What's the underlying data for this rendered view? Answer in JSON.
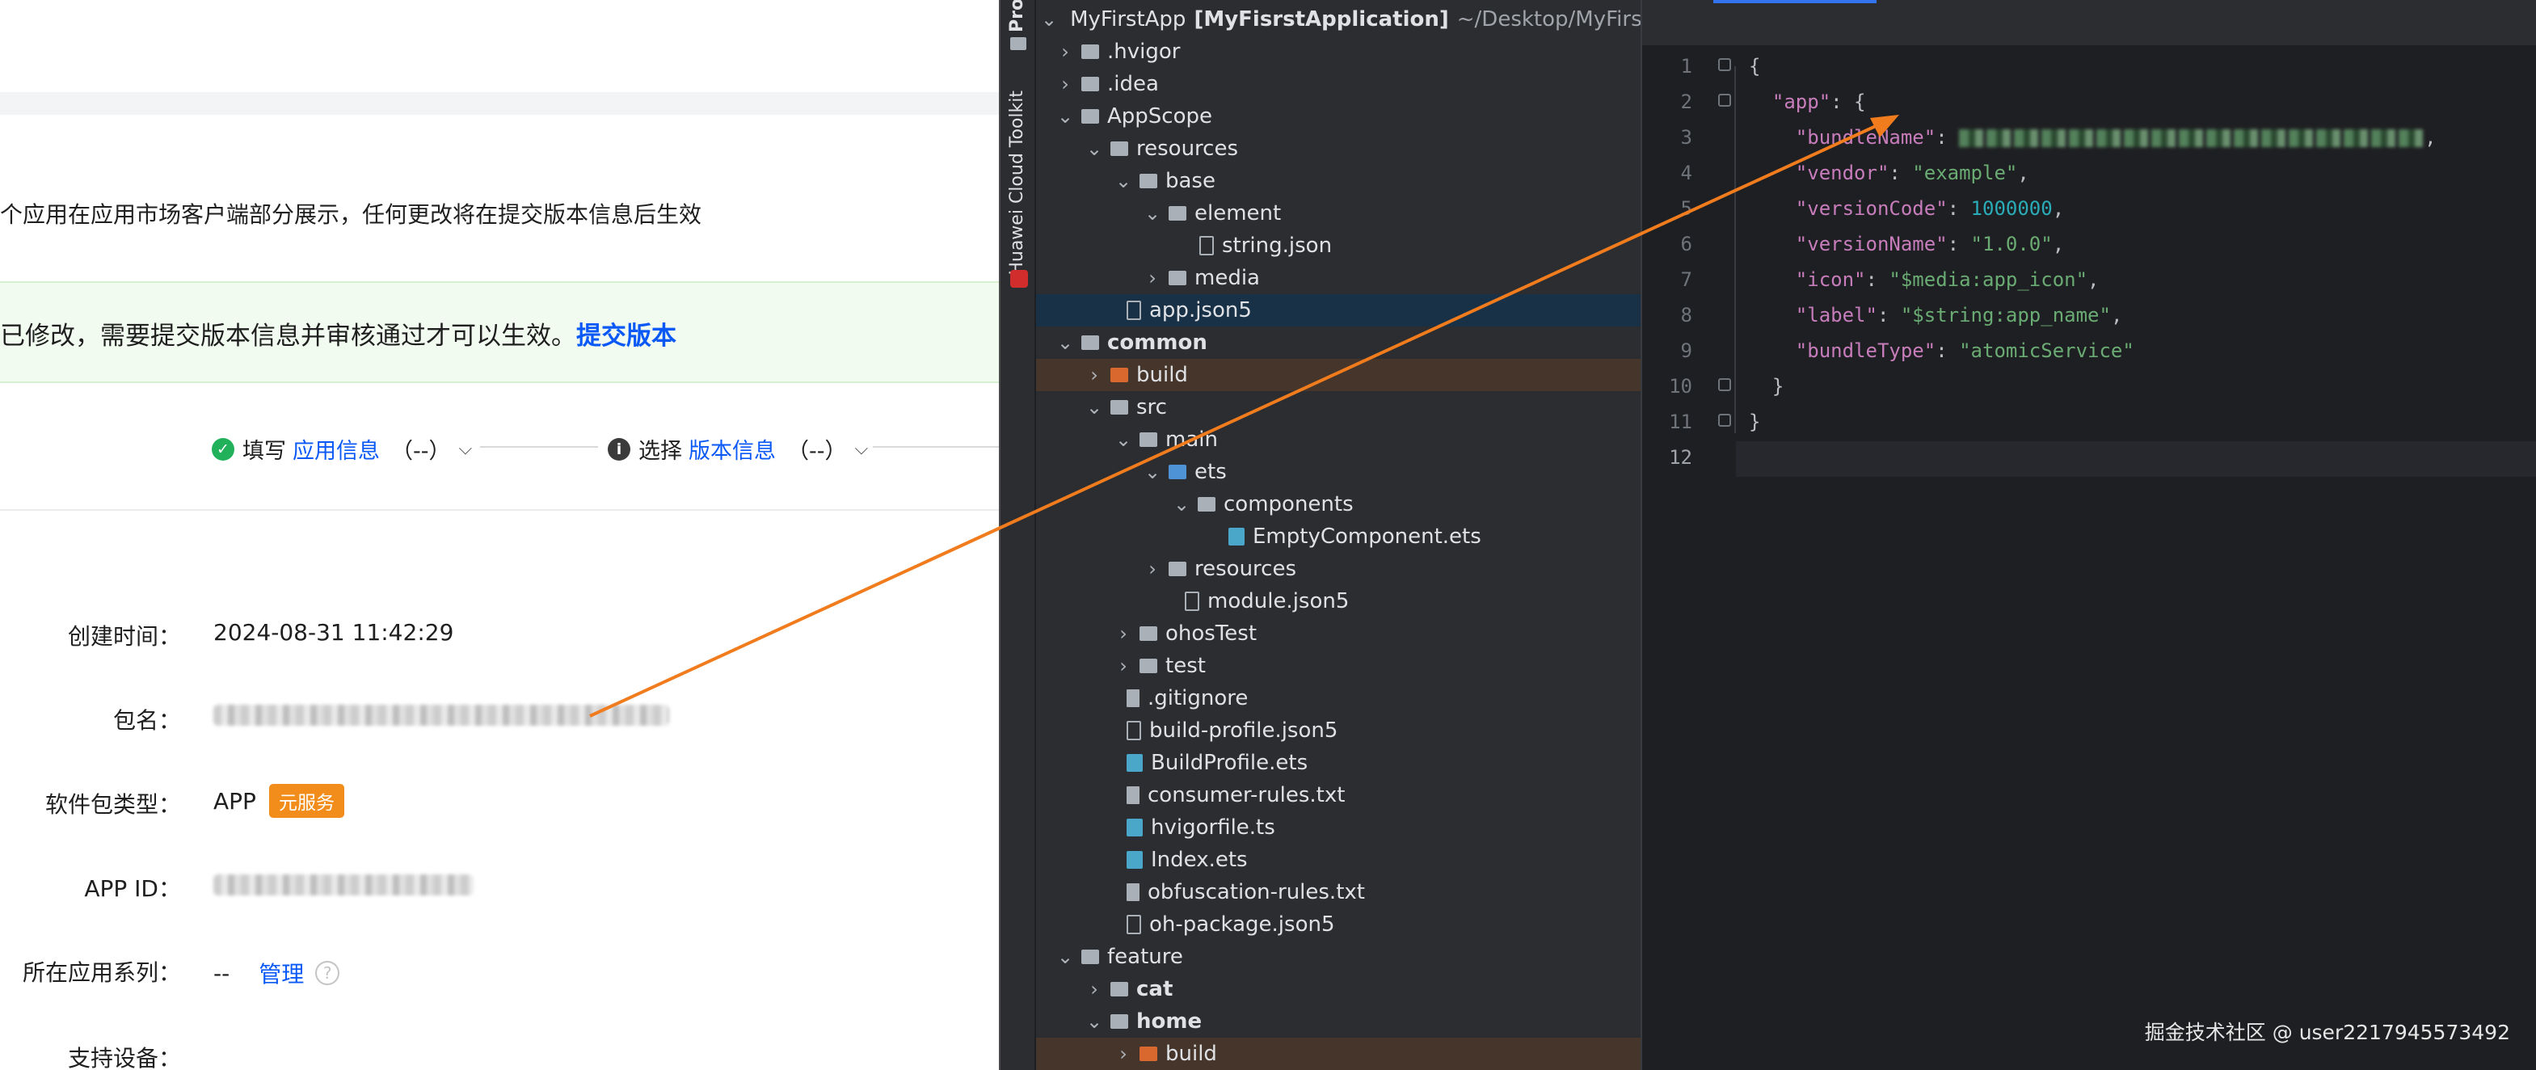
{
  "web": {
    "notice": "个应用在应用市场客户端部分展示，任何更改将在提交版本信息后生效",
    "alert_text": "已修改，需要提交版本信息并审核通过才可以生效。",
    "alert_link": "提交版本",
    "steps": [
      {
        "prefix": "填写",
        "link": "应用信息",
        "suffix": "（--）"
      },
      {
        "prefix": "选择",
        "link": "版本信息",
        "suffix": "（--）"
      }
    ],
    "fields": {
      "created_label": "创建时间：",
      "created_value": "2024-08-31 11:42:29",
      "package_label": "包名：",
      "type_label": "软件包类型：",
      "type_value": "APP",
      "type_tag": "元服务",
      "appid_label": "APP ID：",
      "series_label": "所在应用系列：",
      "series_value": "--",
      "series_manage": "管理",
      "series_help": "?",
      "devices_label": "支持设备："
    }
  },
  "ide": {
    "toolstrip": {
      "project_label": "Pro",
      "cloud_label": "Huawei Cloud Toolkit"
    },
    "tree": {
      "root_name": "MyFirstApp",
      "root_module": "[MyFisrstApplication]",
      "root_path": "~/Desktop/MyFirstAp",
      "items": [
        ".hvigor",
        ".idea",
        "AppScope",
        "resources",
        "base",
        "element",
        "string.json",
        "media",
        "app.json5",
        "common",
        "build",
        "src",
        "main",
        "ets",
        "components",
        "EmptyComponent.ets",
        "resources",
        "module.json5",
        "ohosTest",
        "test",
        ".gitignore",
        "build-profile.json5",
        "BuildProfile.ets",
        "consumer-rules.txt",
        "hvigorfile.ts",
        "Index.ets",
        "obfuscation-rules.txt",
        "oh-package.json5",
        "feature",
        "cat",
        "home",
        "build"
      ]
    },
    "editor": {
      "line_numbers": [
        "1",
        "2",
        "3",
        "4",
        "5",
        "6",
        "7",
        "8",
        "9",
        "10",
        "11",
        "12"
      ],
      "code": {
        "l1": "{",
        "app_key": "\"app\"",
        "bundleName_key": "\"bundleName\"",
        "vendor_key": "\"vendor\"",
        "vendor_val": "\"example\"",
        "versionCode_key": "\"versionCode\"",
        "versionCode_val": "1000000",
        "versionName_key": "\"versionName\"",
        "versionName_val": "\"1.0.0\"",
        "icon_key": "\"icon\"",
        "icon_val": "\"$media:app_icon\"",
        "label_key": "\"label\"",
        "label_val": "\"$string:app_name\"",
        "bundleType_key": "\"bundleType\"",
        "bundleType_val": "\"atomicService\"",
        "l10": "}",
        "l11": "}"
      }
    }
  },
  "watermark": "掘金技术社区 @ user2217945573492",
  "colors": {
    "annotation_arrow": "#f07c1e",
    "link": "#0a59f7",
    "tag": "#f28c1a",
    "selection": "#193146"
  }
}
